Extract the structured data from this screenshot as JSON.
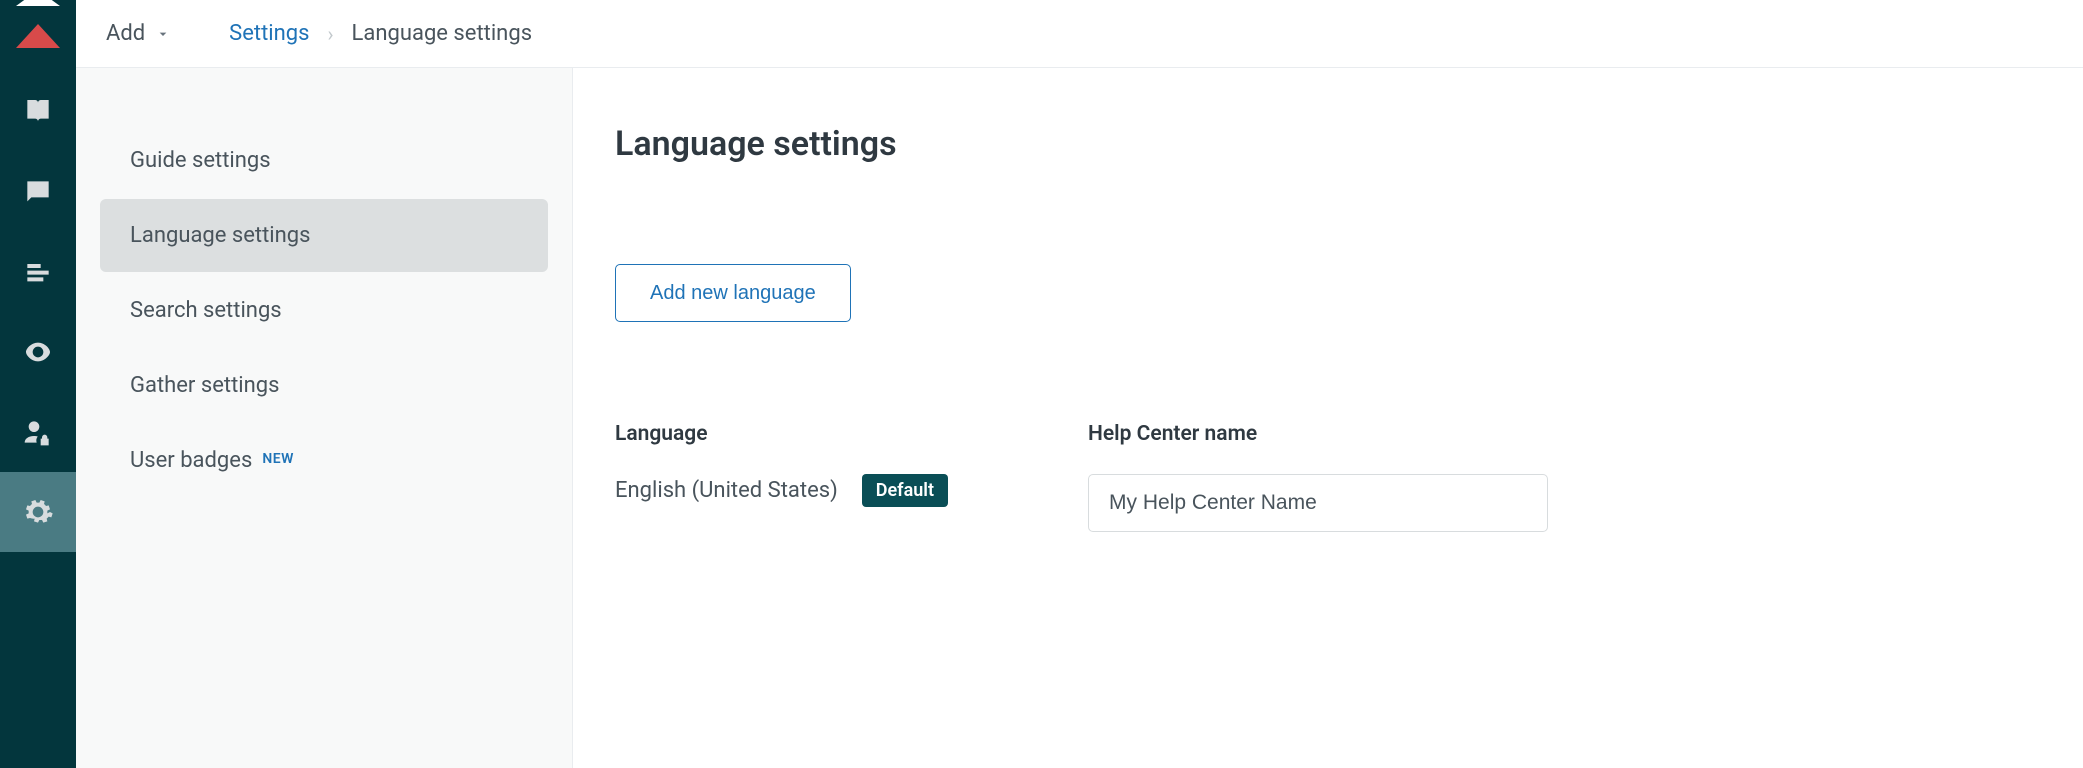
{
  "topbar": {
    "add_label": "Add",
    "crumb_root": "Settings",
    "crumb_current": "Language settings"
  },
  "sidebar": {
    "items": [
      {
        "label": "Guide settings"
      },
      {
        "label": "Language settings"
      },
      {
        "label": "Search settings"
      },
      {
        "label": "Gather settings"
      },
      {
        "label": "User badges",
        "badge": "NEW"
      }
    ]
  },
  "page": {
    "title": "Language settings",
    "add_language_label": "Add new language",
    "col_language": "Language",
    "col_helpcenter": "Help Center name",
    "language_name": "English (United States)",
    "default_tag": "Default",
    "helpcenter_value": "My Help Center Name"
  }
}
